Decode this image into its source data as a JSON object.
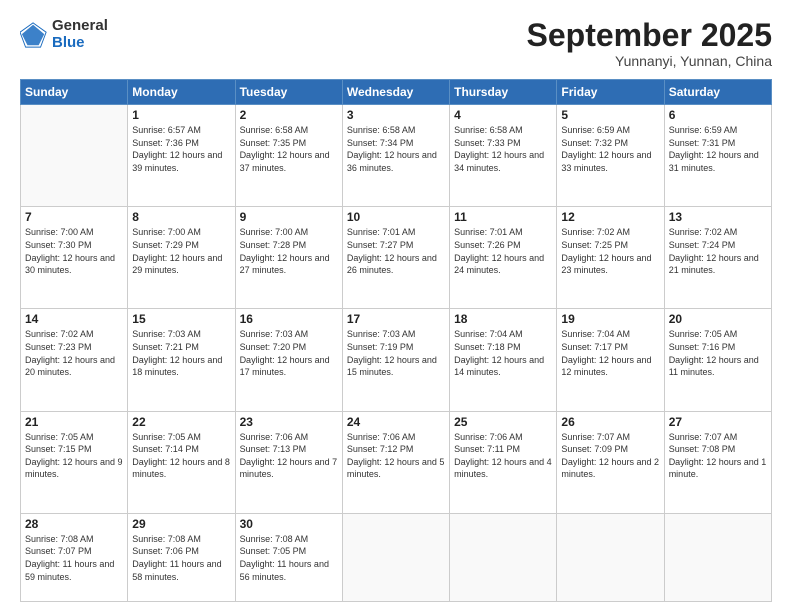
{
  "logo": {
    "general": "General",
    "blue": "Blue"
  },
  "header": {
    "month": "September 2025",
    "location": "Yunnanyi, Yunnan, China"
  },
  "weekdays": [
    "Sunday",
    "Monday",
    "Tuesday",
    "Wednesday",
    "Thursday",
    "Friday",
    "Saturday"
  ],
  "weeks": [
    [
      {
        "day": "",
        "sunrise": "",
        "sunset": "",
        "daylight": ""
      },
      {
        "day": "1",
        "sunrise": "Sunrise: 6:57 AM",
        "sunset": "Sunset: 7:36 PM",
        "daylight": "Daylight: 12 hours and 39 minutes."
      },
      {
        "day": "2",
        "sunrise": "Sunrise: 6:58 AM",
        "sunset": "Sunset: 7:35 PM",
        "daylight": "Daylight: 12 hours and 37 minutes."
      },
      {
        "day": "3",
        "sunrise": "Sunrise: 6:58 AM",
        "sunset": "Sunset: 7:34 PM",
        "daylight": "Daylight: 12 hours and 36 minutes."
      },
      {
        "day": "4",
        "sunrise": "Sunrise: 6:58 AM",
        "sunset": "Sunset: 7:33 PM",
        "daylight": "Daylight: 12 hours and 34 minutes."
      },
      {
        "day": "5",
        "sunrise": "Sunrise: 6:59 AM",
        "sunset": "Sunset: 7:32 PM",
        "daylight": "Daylight: 12 hours and 33 minutes."
      },
      {
        "day": "6",
        "sunrise": "Sunrise: 6:59 AM",
        "sunset": "Sunset: 7:31 PM",
        "daylight": "Daylight: 12 hours and 31 minutes."
      }
    ],
    [
      {
        "day": "7",
        "sunrise": "Sunrise: 7:00 AM",
        "sunset": "Sunset: 7:30 PM",
        "daylight": "Daylight: 12 hours and 30 minutes."
      },
      {
        "day": "8",
        "sunrise": "Sunrise: 7:00 AM",
        "sunset": "Sunset: 7:29 PM",
        "daylight": "Daylight: 12 hours and 29 minutes."
      },
      {
        "day": "9",
        "sunrise": "Sunrise: 7:00 AM",
        "sunset": "Sunset: 7:28 PM",
        "daylight": "Daylight: 12 hours and 27 minutes."
      },
      {
        "day": "10",
        "sunrise": "Sunrise: 7:01 AM",
        "sunset": "Sunset: 7:27 PM",
        "daylight": "Daylight: 12 hours and 26 minutes."
      },
      {
        "day": "11",
        "sunrise": "Sunrise: 7:01 AM",
        "sunset": "Sunset: 7:26 PM",
        "daylight": "Daylight: 12 hours and 24 minutes."
      },
      {
        "day": "12",
        "sunrise": "Sunrise: 7:02 AM",
        "sunset": "Sunset: 7:25 PM",
        "daylight": "Daylight: 12 hours and 23 minutes."
      },
      {
        "day": "13",
        "sunrise": "Sunrise: 7:02 AM",
        "sunset": "Sunset: 7:24 PM",
        "daylight": "Daylight: 12 hours and 21 minutes."
      }
    ],
    [
      {
        "day": "14",
        "sunrise": "Sunrise: 7:02 AM",
        "sunset": "Sunset: 7:23 PM",
        "daylight": "Daylight: 12 hours and 20 minutes."
      },
      {
        "day": "15",
        "sunrise": "Sunrise: 7:03 AM",
        "sunset": "Sunset: 7:21 PM",
        "daylight": "Daylight: 12 hours and 18 minutes."
      },
      {
        "day": "16",
        "sunrise": "Sunrise: 7:03 AM",
        "sunset": "Sunset: 7:20 PM",
        "daylight": "Daylight: 12 hours and 17 minutes."
      },
      {
        "day": "17",
        "sunrise": "Sunrise: 7:03 AM",
        "sunset": "Sunset: 7:19 PM",
        "daylight": "Daylight: 12 hours and 15 minutes."
      },
      {
        "day": "18",
        "sunrise": "Sunrise: 7:04 AM",
        "sunset": "Sunset: 7:18 PM",
        "daylight": "Daylight: 12 hours and 14 minutes."
      },
      {
        "day": "19",
        "sunrise": "Sunrise: 7:04 AM",
        "sunset": "Sunset: 7:17 PM",
        "daylight": "Daylight: 12 hours and 12 minutes."
      },
      {
        "day": "20",
        "sunrise": "Sunrise: 7:05 AM",
        "sunset": "Sunset: 7:16 PM",
        "daylight": "Daylight: 12 hours and 11 minutes."
      }
    ],
    [
      {
        "day": "21",
        "sunrise": "Sunrise: 7:05 AM",
        "sunset": "Sunset: 7:15 PM",
        "daylight": "Daylight: 12 hours and 9 minutes."
      },
      {
        "day": "22",
        "sunrise": "Sunrise: 7:05 AM",
        "sunset": "Sunset: 7:14 PM",
        "daylight": "Daylight: 12 hours and 8 minutes."
      },
      {
        "day": "23",
        "sunrise": "Sunrise: 7:06 AM",
        "sunset": "Sunset: 7:13 PM",
        "daylight": "Daylight: 12 hours and 7 minutes."
      },
      {
        "day": "24",
        "sunrise": "Sunrise: 7:06 AM",
        "sunset": "Sunset: 7:12 PM",
        "daylight": "Daylight: 12 hours and 5 minutes."
      },
      {
        "day": "25",
        "sunrise": "Sunrise: 7:06 AM",
        "sunset": "Sunset: 7:11 PM",
        "daylight": "Daylight: 12 hours and 4 minutes."
      },
      {
        "day": "26",
        "sunrise": "Sunrise: 7:07 AM",
        "sunset": "Sunset: 7:09 PM",
        "daylight": "Daylight: 12 hours and 2 minutes."
      },
      {
        "day": "27",
        "sunrise": "Sunrise: 7:07 AM",
        "sunset": "Sunset: 7:08 PM",
        "daylight": "Daylight: 12 hours and 1 minute."
      }
    ],
    [
      {
        "day": "28",
        "sunrise": "Sunrise: 7:08 AM",
        "sunset": "Sunset: 7:07 PM",
        "daylight": "Daylight: 11 hours and 59 minutes."
      },
      {
        "day": "29",
        "sunrise": "Sunrise: 7:08 AM",
        "sunset": "Sunset: 7:06 PM",
        "daylight": "Daylight: 11 hours and 58 minutes."
      },
      {
        "day": "30",
        "sunrise": "Sunrise: 7:08 AM",
        "sunset": "Sunset: 7:05 PM",
        "daylight": "Daylight: 11 hours and 56 minutes."
      },
      {
        "day": "",
        "sunrise": "",
        "sunset": "",
        "daylight": ""
      },
      {
        "day": "",
        "sunrise": "",
        "sunset": "",
        "daylight": ""
      },
      {
        "day": "",
        "sunrise": "",
        "sunset": "",
        "daylight": ""
      },
      {
        "day": "",
        "sunrise": "",
        "sunset": "",
        "daylight": ""
      }
    ]
  ]
}
